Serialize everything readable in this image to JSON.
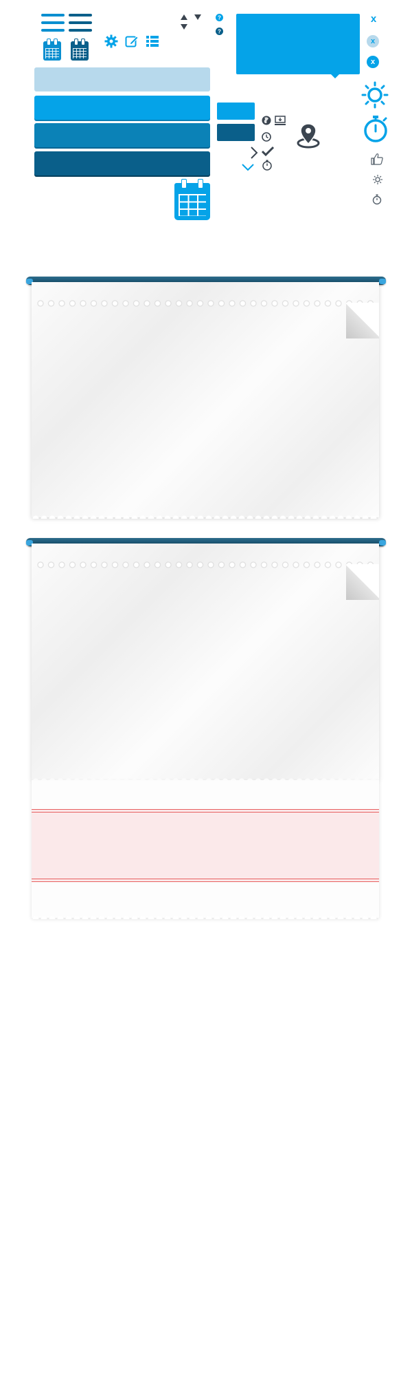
{
  "colors": {
    "accent": "#05a3e8",
    "dark_blue": "#0a5f8a",
    "mid_blue": "#0b82b7",
    "light_blue": "#b7d9ec",
    "icon_gray": "#3b4550",
    "note_pink": "#fbe9ea",
    "note_red_line": "#e86060"
  },
  "icons": {
    "menu_light": "menu-icon",
    "menu_dark": "menu-icon",
    "calendar_light": "calendar-icon",
    "calendar_dark": "calendar-icon",
    "settings": "gear-icon",
    "edit": "edit-icon",
    "list": "list-icon",
    "sort_up": "triangle-up-icon",
    "sort_down": "triangle-down-icon",
    "help": "question-icon",
    "close": "close-icon",
    "globe": "globe-icon",
    "download": "download-icon",
    "clock": "clock-icon",
    "chevron_right": "chevron-right-icon",
    "check": "check-icon",
    "stopwatch": "stopwatch-icon",
    "chevron_down": "chevron-down-icon",
    "location": "location-pin-icon",
    "sun": "sun-icon",
    "thumbs_up": "thumbs-up-icon"
  },
  "close_buttons": {
    "plain_label": "x",
    "light_label": "x",
    "solid_label": "x"
  }
}
